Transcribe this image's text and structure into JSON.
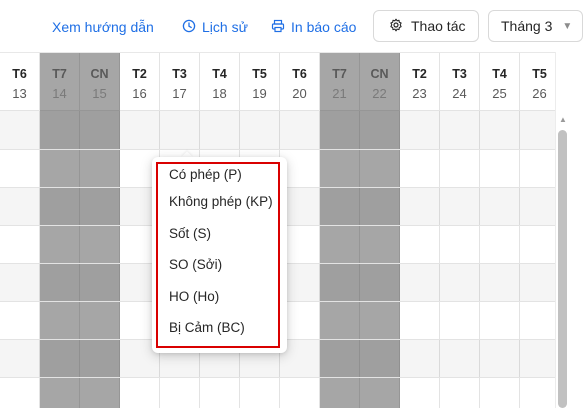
{
  "toolbar": {
    "guide_label": "Xem hướng dẫn",
    "history_label": "Lịch sử",
    "print_label": "In báo cáo",
    "actions_label": "Thao tác",
    "month_value": "Tháng 3",
    "icons": [
      "clock-icon",
      "printer-icon",
      "gear-icon",
      "chevron-down-icon"
    ],
    "link_color": "#1f6fe5"
  },
  "calendar": {
    "days": [
      {
        "weekday": "T6",
        "day": "13",
        "weekend": false
      },
      {
        "weekday": "T7",
        "day": "14",
        "weekend": true
      },
      {
        "weekday": "CN",
        "day": "15",
        "weekend": true
      },
      {
        "weekday": "T2",
        "day": "16",
        "weekend": false
      },
      {
        "weekday": "T3",
        "day": "17",
        "weekend": false
      },
      {
        "weekday": "T4",
        "day": "18",
        "weekend": false
      },
      {
        "weekday": "T5",
        "day": "19",
        "weekend": false
      },
      {
        "weekday": "T6",
        "day": "20",
        "weekend": false
      },
      {
        "weekday": "T7",
        "day": "21",
        "weekend": true
      },
      {
        "weekday": "CN",
        "day": "22",
        "weekend": true
      },
      {
        "weekday": "T2",
        "day": "23",
        "weekend": false
      },
      {
        "weekday": "T3",
        "day": "24",
        "weekend": false
      },
      {
        "weekday": "T4",
        "day": "25",
        "weekend": false
      },
      {
        "weekday": "T5",
        "day": "26",
        "weekend": false
      }
    ],
    "weekend_color": "#a6a6a6"
  },
  "leave_menu": {
    "options": [
      "Có phép (P)",
      "Không phép (KP)",
      "Sốt (S)",
      "SO (Sởi)",
      "HO (Ho)",
      "Bị Cảm (BC)"
    ],
    "highlight_color": "#d90000"
  }
}
